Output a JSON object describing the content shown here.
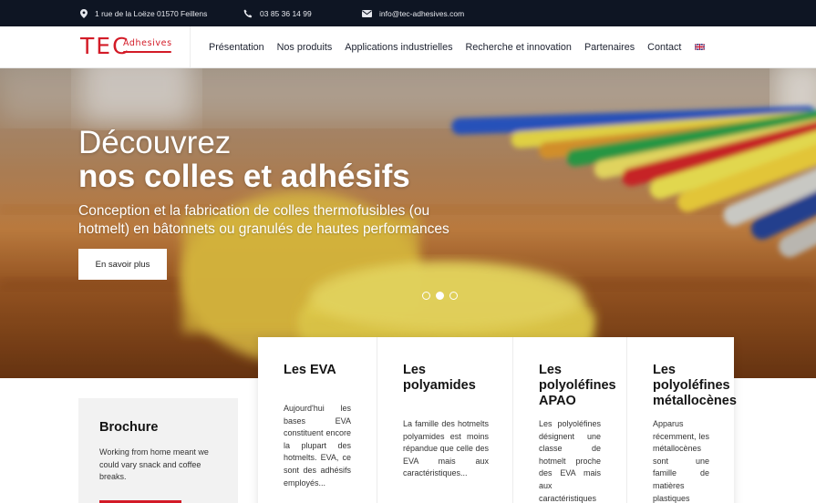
{
  "topbar": {
    "address": "1 rue de la Loëze 01570 Feillens",
    "phone": "03 85 36 14 99",
    "email": "info@tec-adhesives.com"
  },
  "logo": {
    "main": "TEC",
    "sub": "Adhesives"
  },
  "nav": {
    "items": [
      "Présentation",
      "Nos produits",
      "Applications industrielles",
      "Recherche et innovation",
      "Partenaires",
      "Contact"
    ],
    "language_icon": "uk-flag-icon"
  },
  "hero": {
    "title_line1": "Découvrez",
    "title_line2": "nos colles et adhésifs",
    "subtitle": "Conception et la fabrication de colles thermofusibles (ou hotmelt) en bâtonnets ou granulés de hautes performances",
    "button": "En savoir plus",
    "slides_total": 3,
    "slide_active": 2
  },
  "brochure": {
    "title": "Brochure",
    "text": "Working from home meant we could vary snack and coffee breaks."
  },
  "products": [
    {
      "title": "Les EVA",
      "text": "Aujourd'hui les bases EVA constituent encore la plupart des hotmelts. EVA, ce sont des adhésifs employés..."
    },
    {
      "title": "Les polyamides",
      "text": "La famille des hotmelts polyamides est moins répandue que celle des EVA mais aux caractéristiques..."
    },
    {
      "title": "Les polyoléfines APAO",
      "text": "Les polyoléfines désignent une classe de hotmelt proche des EVA mais aux caractéristiques amélio-"
    },
    {
      "title": "Les polyoléfines métallocènes",
      "text": "Apparus récemment, les métallocènes sont une famille de matières plastiques"
    }
  ],
  "colors": {
    "brand_red": "#d31b27",
    "topbar_bg": "#0e1523",
    "nav_text": "#1d2230"
  }
}
